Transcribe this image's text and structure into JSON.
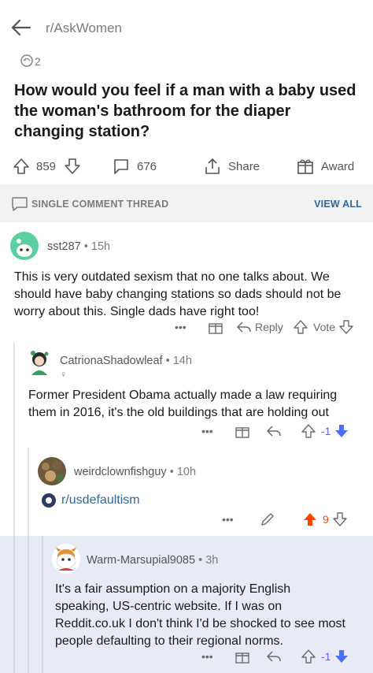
{
  "header": {
    "subreddit": "r/AskWomen"
  },
  "post": {
    "award_count": "2",
    "title": "How would you feel if a man with a baby used the woman's bathroom for the diaper changing station?",
    "votes": "859",
    "comments": "676",
    "share_label": "Share",
    "award_label": "Award"
  },
  "thread": {
    "label": "SINGLE COMMENT THREAD",
    "view_all": "VIEW ALL"
  },
  "comments": [
    {
      "user": "sst287",
      "time": "15h",
      "body": "This is very outdated sexism that no one talks about. We should have baby changing stations so dads should not be worry about this. Single dads have right too!",
      "more": "•••",
      "reply_label": "Reply",
      "vote_label": "Vote"
    },
    {
      "user": "CatrionaShadowleaf",
      "time": "14h",
      "flair": "♀",
      "body": "Former President Obama actually made a law requiring them in 2016, it's the old buildings that are holding out",
      "more": "•••",
      "score": "-1"
    },
    {
      "user": "weirdclownfishguy",
      "time": "10h",
      "link": "r/usdefaultism",
      "more": "•••",
      "score": "9"
    },
    {
      "user": "Warm-Marsupial9085",
      "time": "3h",
      "body": "It's a fair assumption on a majority English speaking, US-centric website. If I was on Reddit.co.uk I don't think I'd be shocked to see most people defaulting to their regional norms.",
      "more": "•••",
      "score": "-1"
    }
  ],
  "colors": {
    "upvote": "#ff4500",
    "downvote": "#7193ff",
    "link": "#33669a",
    "highlight_bg": "#e6ebf5"
  },
  "icons": [
    "back-arrow-icon",
    "award-icon",
    "upvote-icon",
    "downvote-icon",
    "comment-icon",
    "share-icon",
    "gift-icon",
    "chat-bubble-icon",
    "reply-icon",
    "edit-icon",
    "subreddit-icon"
  ]
}
